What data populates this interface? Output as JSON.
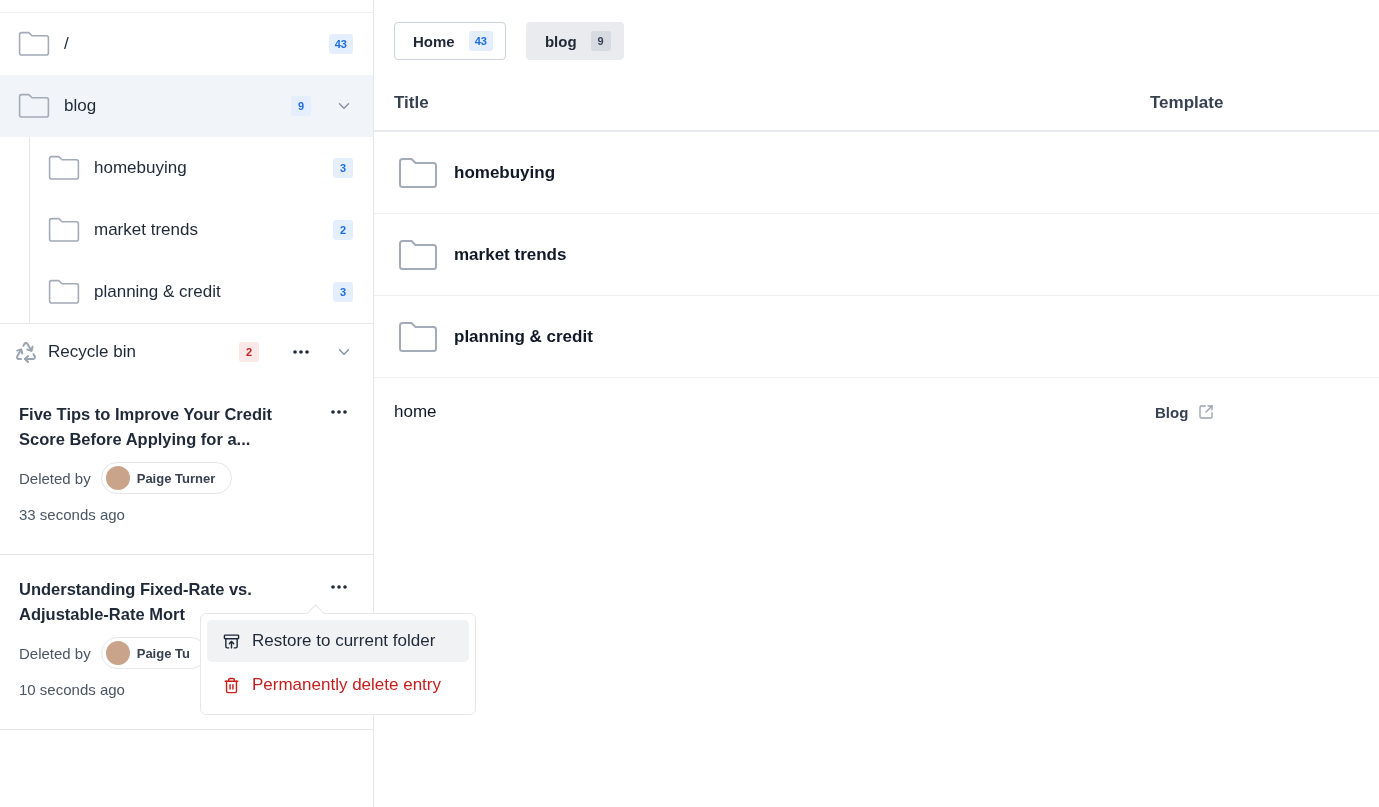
{
  "sidebar": {
    "tree": [
      {
        "label": "/",
        "count": "43",
        "selected": false
      },
      {
        "label": "blog",
        "count": "9",
        "selected": true,
        "children": [
          {
            "label": "homebuying",
            "count": "3",
            "selected": false
          },
          {
            "label": "market trends",
            "count": "2",
            "selected": false
          },
          {
            "label": "planning & credit",
            "count": "3",
            "selected": false
          }
        ]
      }
    ],
    "recycle_bin": {
      "label": "Recycle bin",
      "count": "2",
      "entries": [
        {
          "title": "Five Tips to Improve Your Credit Score Before Applying for a...",
          "deleted_by": "Deleted by",
          "user": "Paige Turner",
          "time": "33 seconds ago"
        },
        {
          "title": "Understanding Fixed-Rate vs. Adjustable-Rate Mort",
          "deleted_by": "Deleted by",
          "user": "Paige Tu",
          "time": "10 seconds ago",
          "context_menu": {
            "items": [
              {
                "kind": "restore",
                "label": "Restore to current folder",
                "selected": true
              },
              {
                "kind": "delete",
                "label": "Permanently delete entry",
                "selected": false
              }
            ]
          }
        }
      ]
    }
  },
  "tabs": [
    {
      "label": "Home",
      "count": "43",
      "selected": false
    },
    {
      "label": "blog",
      "count": "9",
      "selected": true
    }
  ],
  "table": {
    "columns": [
      "Title",
      "Template"
    ],
    "rows": [
      {
        "kind": "folder",
        "title": "homebuying"
      },
      {
        "kind": "folder",
        "title": "market trends"
      },
      {
        "kind": "folder",
        "title": "planning & credit"
      },
      {
        "kind": "page",
        "title": "home",
        "template": "Blog"
      }
    ]
  }
}
